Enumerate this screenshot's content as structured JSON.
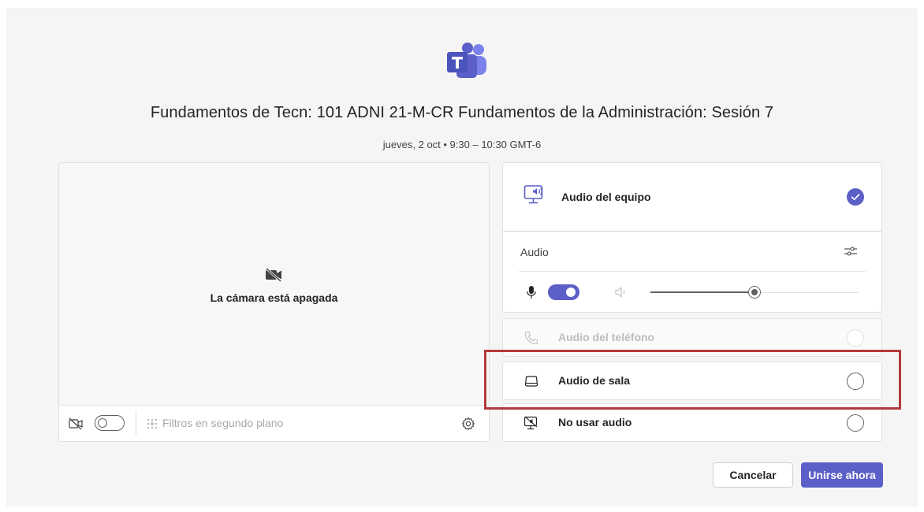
{
  "meeting": {
    "title": "Fundamentos de Tecn: 101 ADNI 21-M-CR Fundamentos de la Administración: Sesión 7",
    "datetime": "jueves, 2 oct  •  9:30  –  10:30 GMT-6"
  },
  "preview": {
    "camera_off_text": "La cámara está apagada",
    "camera_toggle_on": false,
    "filters_label": "Filtros en segundo plano"
  },
  "audio": {
    "computer_audio_label": "Audio del equipo",
    "computer_audio_selected": true,
    "audio_sub_label": "Audio",
    "mic_on": true,
    "volume_fraction": 0.5,
    "phone_audio_label": "Audio del teléfono",
    "room_audio_label": "Audio de sala",
    "no_audio_label": "No usar audio"
  },
  "actions": {
    "cancel_label": "Cancelar",
    "join_label": "Unirse ahora"
  },
  "colors": {
    "accent": "#5b5fc7",
    "highlight": "#b5393a"
  },
  "icons": [
    "teams-logo-icon",
    "camera-off-icon",
    "gear-icon",
    "computer-audio-icon",
    "check-icon",
    "sliders-icon",
    "mic-icon",
    "speaker-icon",
    "phone-icon",
    "room-audio-icon",
    "no-audio-icon",
    "filters-icon"
  ]
}
